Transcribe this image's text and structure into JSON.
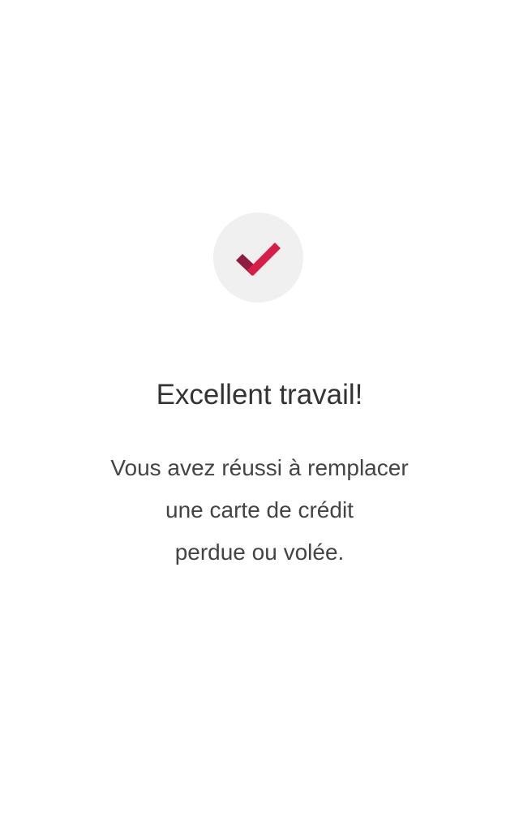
{
  "success": {
    "icon": "checkmark-icon",
    "icon_colors": {
      "circle": "#f0f0f0",
      "check_dark": "#8e1d3f",
      "check_light": "#d81e46"
    },
    "title": "Excellent travail!",
    "message_lines": [
      "Vous avez réussi à remplacer",
      "une carte de crédit",
      "perdue ou volée."
    ]
  }
}
